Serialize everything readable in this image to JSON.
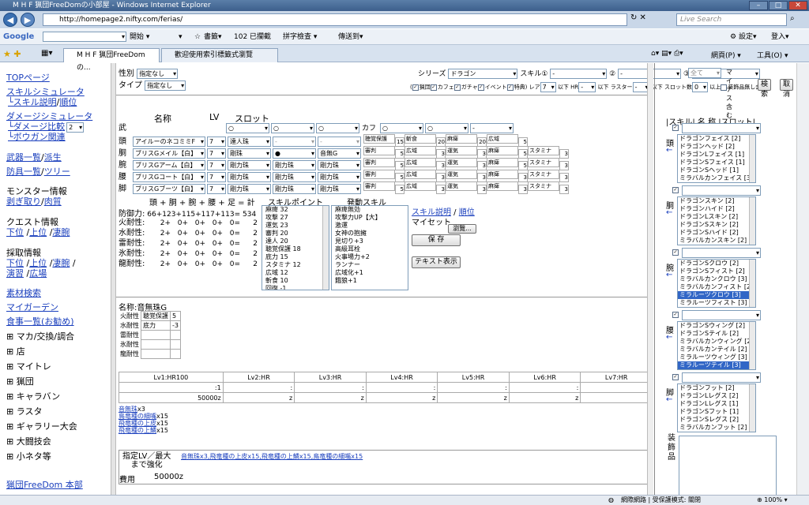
{
  "window": {
    "title": "M H F 猟団FreeDomの小部屋 - Windows Internet Explorer"
  },
  "browser": {
    "url": "http://homepage2.nifty.com/ferias/",
    "search_placeholder": "Live Search",
    "google_label": "Google",
    "toolbar_items": [
      "開始 ▾",
      "▾",
      "書籤▾",
      "102 已攔截",
      "拼字檢查 ▾",
      "傳送到▾"
    ],
    "settings": "設定▾",
    "login": "登入▾",
    "tabs": [
      "M H F 猟団FreeDomの...",
      "歡迎使用索引標籤式瀏覽"
    ],
    "cmd": [
      "網頁(P) ▾",
      "工具(O) ▾"
    ]
  },
  "left_nav": {
    "top": "TOPページ",
    "skill_sim": "スキルシミュレータ",
    "skill_desc": "└スキル説明",
    "order": "順位",
    "dmg_sim": "ダメージシミュレータ",
    "dmg_cmp": "└ダメージ比較",
    "dmg_sel": "2",
    "bowgun": "└ボウガン関連",
    "weapons": "武器一覧",
    "sos": "派生",
    "armor": "防具一覧",
    "tree": "ツリー",
    "monster": "モンスター情報",
    "strip": "剥ぎ取り",
    "meat": "肉質",
    "quest": "クエスト情報",
    "low": "下位",
    "high": "上位",
    "sub": "凄腕",
    "gather": "採取情報",
    "g_low": "下位",
    "g_high": "上位",
    "g_sub": "凄腕",
    "ensyu": "演習",
    "hiroba": "広場",
    "material": "素材検索",
    "my_garden": "マイガーデン",
    "food": "食事一覧",
    "food_rec": "(お勧め)",
    "trees": [
      "マカ/交換/調合",
      "店",
      "マイトレ",
      "猟団",
      "キャラバン",
      "ラスタ",
      "ギャラリー大会",
      "大闘技会",
      "小ネタ等"
    ],
    "home": "猟団FreeDom 本部"
  },
  "filter": {
    "sex_label": "性別",
    "sex_val": "指定なし",
    "type_label": "タイプ",
    "type_val": "指定なし",
    "series_label": "シリーズ",
    "series_val": "ドラゴン",
    "skill1_label": "スキル①",
    "skill1_val": "-",
    "skill2_label": "②",
    "skill2_val": "-",
    "skill3_label": "③",
    "skill3_val": "-",
    "all_val": "全て",
    "minus": "マイナス含む",
    "search": "検索",
    "cancel": "取消",
    "checks": [
      "猟団",
      "カフェ",
      "ガチャ",
      "イベント",
      "特典"
    ],
    "rare_label": "レア",
    "rare_val": "7",
    "hr_label": "以下 HR",
    "hr_val": "-",
    "rasta_label": "以下 ラスター",
    "rasta_val": "-",
    "slot_label": "以下 スロット数",
    "slot_val": "0",
    "slot_tail": "以上",
    "no_deco": "装飾品無し含む"
  },
  "equip": {
    "head_name": "名称",
    "head_lv": "LV",
    "head_slot": "スロット",
    "karu": "カフ",
    "rows": [
      {
        "part": "武",
        "name": "",
        "lv": "",
        "s1": "○",
        "s2": "○",
        "s3": "○"
      },
      {
        "part": "頭",
        "name": "アイルーのネコミミF",
        "lv": "7",
        "s1": "達人珠",
        "s2": "-",
        "s3": "-",
        "sk": [
          [
            "聴覚保護",
            "15"
          ],
          [
            "斬食",
            "20"
          ],
          [
            "麻痺",
            "20"
          ],
          [
            "広域",
            "5"
          ]
        ]
      },
      {
        "part": "胴",
        "name": "ブリスGメイル【白】",
        "lv": "7",
        "s1": "剛珠",
        "s2": "●",
        "s3": "音無G",
        "sk": [
          [
            "審判",
            "5"
          ],
          [
            "広域",
            "3"
          ],
          [
            "運気",
            "3"
          ],
          [
            "麻痺",
            "5"
          ],
          [
            "スタミナ",
            "3"
          ]
        ]
      },
      {
        "part": "腕",
        "name": "ブリスGアーム【白】",
        "lv": "7",
        "s1": "剛力珠",
        "s2": "剛力珠",
        "s3": "剛力珠",
        "sk": [
          [
            "審判",
            "5"
          ],
          [
            "広域",
            "3"
          ],
          [
            "運気",
            "3"
          ],
          [
            "麻痺",
            "5"
          ],
          [
            "スタミナ",
            "3"
          ]
        ]
      },
      {
        "part": "腰",
        "name": "ブリスGコート【白】",
        "lv": "7",
        "s1": "剛力珠",
        "s2": "剛力珠",
        "s3": "剛力珠",
        "sk": [
          [
            "審判",
            "5"
          ],
          [
            "広域",
            "3"
          ],
          [
            "運気",
            "3"
          ],
          [
            "麻痺",
            "3"
          ],
          [
            "スタミナ",
            "3"
          ]
        ]
      },
      {
        "part": "脚",
        "name": "ブリスGブーツ【白】",
        "lv": "7",
        "s1": "剛力珠",
        "s2": "剛力珠",
        "s3": "剛力珠",
        "sk": [
          [
            "審判",
            "5"
          ],
          [
            "広域",
            "3"
          ],
          [
            "運気",
            "3"
          ],
          [
            "麻痺",
            "3"
          ],
          [
            "スタミナ",
            "3"
          ]
        ]
      }
    ],
    "sum_header": "頭 + 胴 + 腕 + 腰 + 足 =  計",
    "sp_header": "スキルポイント",
    "act_header": "発動スキル",
    "def_label": "防御力:",
    "def_val": "66+123+115+117+113=",
    "def_total": "534",
    "res": [
      [
        "火耐性:",
        "2+",
        "0+",
        "0+",
        "0+",
        "0=",
        "2"
      ],
      [
        "水耐性:",
        "2+",
        "0+",
        "0+",
        "0+",
        "0=",
        "2"
      ],
      [
        "雷耐性:",
        "2+",
        "0+",
        "0+",
        "0+",
        "0=",
        "2"
      ],
      [
        "氷耐性:",
        "2+",
        "0+",
        "0+",
        "0+",
        "0=",
        "2"
      ],
      [
        "龍耐性:",
        "2+",
        "0+",
        "0+",
        "0+",
        "0=",
        "2"
      ]
    ],
    "points": [
      "麻痺 32",
      "攻撃 27",
      "運気 23",
      "審判 20",
      "達人 20",
      "聴覚保護 18",
      "底力 15",
      "スタミナ 12",
      "広域 12",
      "斬食 10",
      "回復 -1"
    ],
    "actives": [
      "麻痺無効",
      "攻撃力UP【大】",
      "激運",
      "女神の抱擁",
      "見切り+3",
      "高級耳栓",
      "火事場力+2",
      "ランナー",
      "広域化+1",
      "餓狼+1"
    ],
    "skill_desc": "スキル説明",
    "order": "順位",
    "myset": "マイセット",
    "browse": "瀏覽...",
    "save": "保 存",
    "text": "テキスト表示"
  },
  "deco": {
    "name": "名称:音無珠G",
    "res": [
      "火耐性",
      "水耐性",
      "雷耐性",
      "氷耐性",
      "龍耐性"
    ],
    "sk1": "聴覚保護",
    "v1": "5",
    "sk2": "底力",
    "v2": "-3"
  },
  "upgrade": {
    "headers": [
      "Lv1:HR100",
      "Lv2:HR",
      "Lv3:HR",
      "Lv4:HR",
      "Lv5:HR",
      "Lv6:HR",
      "Lv7:HR"
    ],
    "row2": [
      ":1",
      ":",
      ":",
      ":",
      ":",
      ":",
      ":"
    ],
    "row3": [
      "50000z",
      "z",
      "z",
      "z",
      "z",
      "z",
      "z"
    ],
    "mats": [
      "音無珠",
      "x3",
      "鳥竜種の細嘴",
      "x15",
      "飛竜種の上皮",
      "x15",
      "飛竜種の上鱗",
      "x15"
    ],
    "lv_label": "指定LV／最大",
    "lv_label2": "まで強化",
    "line": "音無珠x3,飛竜種の上皮x15,飛竜種の上鱗x15,鳥竜種の細嘴x15",
    "cost_label": "費用",
    "cost": "50000z"
  },
  "right": {
    "header": "|スキル| 名 称 |スロット|",
    "parts": [
      "頭",
      "胴",
      "腕",
      "腰",
      "脚"
    ],
    "deco_label": "装飾品",
    "head": [
      "ドラゴンフェイス [2]",
      "ドラゴンヘッド [2]",
      "ドラゴンLフェイス [1]",
      "ドラゴンSフェイス [1]",
      "ドラゴンSヘッド [1]",
      "ミラバルカンフェイス [3]"
    ],
    "body": [
      "ドラゴンスキン [2]",
      "ドラゴンハイド [2]",
      "ドラゴンLスキン [2]",
      "ドラゴンSスキン [2]",
      "ドラゴンSハイド [2]",
      "ミラバルカンスキン [2]"
    ],
    "arm": [
      "ドラゴンSクロウ [2]",
      "ドラゴンSフィスト [2]",
      "ミラバルカンクロウ [3]",
      "ミラバルカンフィスト [2]",
      "ミラルーツクロウ [3]",
      "ミラルーツフィスト [3]"
    ],
    "waist": [
      "ドラゴンSウィング [2]",
      "ドラゴンSテイル [2]",
      "ミラバルカンウィング [2]",
      "ミラバルカンテイル [2]",
      "ミラルーツウィング [3]",
      "ミラルーツテイル [3]"
    ],
    "leg": [
      "ドラゴンフット [2]",
      "ドラゴンLレグス [2]",
      "ドラゴンLレグス [1]",
      "ドラゴンSフット [1]",
      "ドラゴンSレグス [2]",
      "ミラバルカンフット [2]"
    ]
  },
  "status": {
    "zone": "網際網路 | 受保護模式: 關閉",
    "zoom": "100%"
  }
}
